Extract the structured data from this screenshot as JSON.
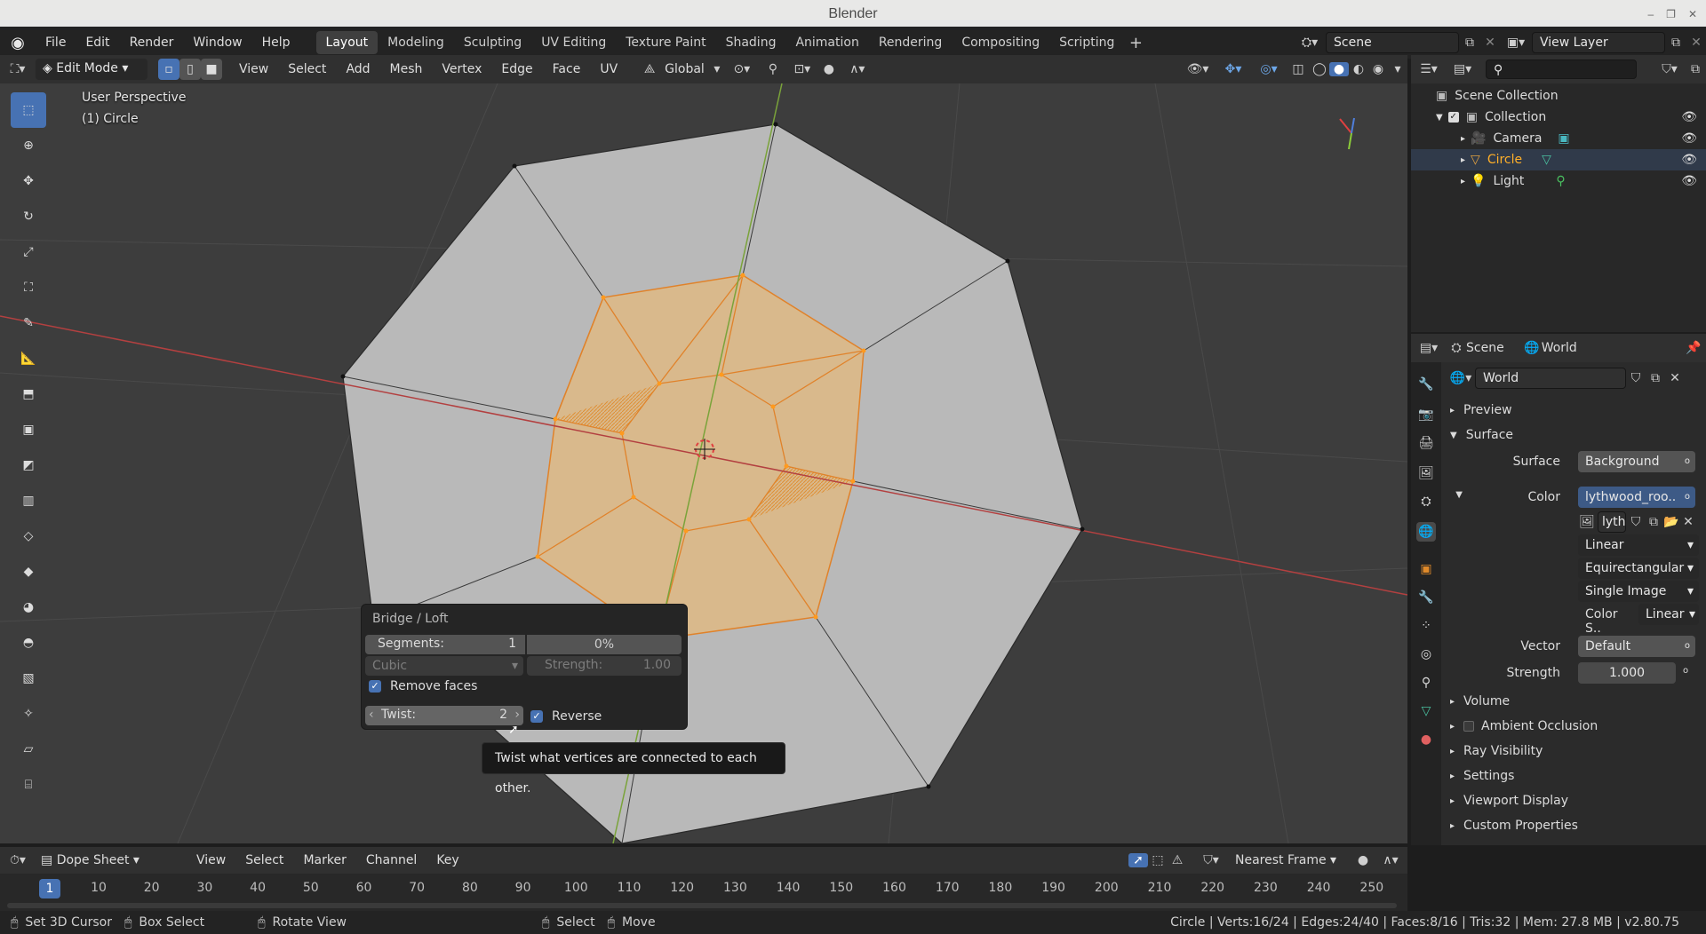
{
  "window": {
    "title": "Blender"
  },
  "menus": [
    "File",
    "Edit",
    "Render",
    "Window",
    "Help"
  ],
  "workspaces": [
    "Layout",
    "Modeling",
    "Sculpting",
    "UV Editing",
    "Texture Paint",
    "Shading",
    "Animation",
    "Rendering",
    "Compositing",
    "Scripting"
  ],
  "active_workspace": "Layout",
  "scene": {
    "name": "Scene",
    "view_layer": "View Layer"
  },
  "viewport": {
    "mode": "Edit Mode",
    "menus": [
      "View",
      "Select",
      "Add",
      "Mesh",
      "Vertex",
      "Edge",
      "Face",
      "UV"
    ],
    "orientation": "Global",
    "perspective_label": "User Perspective",
    "object_label": "(1) Circle"
  },
  "redo_panel": {
    "title": "Bridge / Loft",
    "segments_label": "Segments:",
    "segments_value": "1",
    "percent": "0%",
    "interp": "Cubic",
    "strength_label": "Strength:",
    "strength_value": "1.00",
    "remove_faces": "Remove faces",
    "twist_label": "Twist:",
    "twist_value": "2",
    "reverse": "Reverse"
  },
  "tooltip": "Twist what vertices are connected to each other.",
  "outliner": {
    "root": "Scene Collection",
    "collection": "Collection",
    "items": [
      "Camera",
      "Circle",
      "Light"
    ]
  },
  "properties": {
    "scene_tab": "Scene",
    "world_tab": "World",
    "world_name": "World",
    "preview": "Preview",
    "surface_panel": "Surface",
    "surface_label": "Surface",
    "surface_value": "Background",
    "color_label": "Color",
    "color_value": "lythwood_roo..",
    "image_name": "lyth",
    "interp": "Linear",
    "projection": "Equirectangular",
    "source": "Single Image",
    "colorspace_label": "Color S..",
    "colorspace_value": "Linear",
    "vector_label": "Vector",
    "vector_value": "Default",
    "strength_label": "Strength",
    "strength_value": "1.000",
    "panels": [
      "Volume",
      "Ambient Occlusion",
      "Ray Visibility",
      "Settings",
      "Viewport Display",
      "Custom Properties"
    ]
  },
  "timeline": {
    "editor": "Dope Sheet",
    "menus": [
      "View",
      "Select",
      "Marker",
      "Channel",
      "Key"
    ],
    "snap": "Nearest Frame",
    "current_frame": "1",
    "frames": [
      "10",
      "20",
      "30",
      "40",
      "50",
      "60",
      "70",
      "80",
      "90",
      "100",
      "110",
      "120",
      "130",
      "140",
      "150",
      "160",
      "170",
      "180",
      "190",
      "200",
      "210",
      "220",
      "230",
      "240",
      "250"
    ]
  },
  "statusbar": {
    "hints": [
      "Set 3D Cursor",
      "Box Select",
      "Rotate View",
      "Select",
      "Move"
    ],
    "stats": "Circle | Verts:16/24 | Edges:24/40 | Faces:8/16 | Tris:32 | Mem: 27.8 MB | v2.80.75"
  },
  "colors": {
    "accent": "#4772b3",
    "selection": "#ffa000",
    "x_axis": "#b34040",
    "y_axis": "#7aa33a"
  }
}
